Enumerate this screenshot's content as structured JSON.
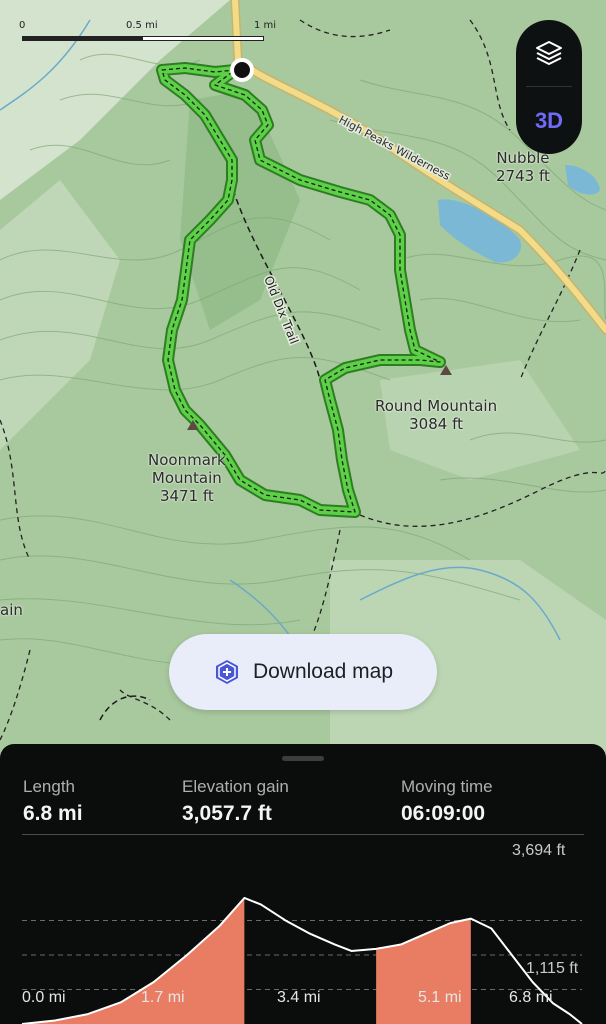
{
  "map": {
    "scale": {
      "tick_0": "0",
      "tick_1": "0.5 mi",
      "tick_2": "1 mi"
    },
    "labels": {
      "nubble": "Nubble\n2743 ft",
      "round_mountain": "Round Mountain\n3084 ft",
      "noonmark": "Noonmark\nMountain\n3471 ft",
      "partial": "ain",
      "old_dix_trail": "Old Dix Trail",
      "high_peaks": "High Peaks Wilderness"
    },
    "colors": {
      "route": "#4fbf3a",
      "road": "#f2dc8a",
      "water": "#7ab8d6",
      "terrain": "#a9c9a0"
    }
  },
  "controls": {
    "layers_icon": "layers-icon",
    "btn_3d": "3D"
  },
  "download": {
    "label": "Download map",
    "icon": "shield-plus-icon"
  },
  "stats": {
    "length_label": "Length",
    "length_value": "6.8 mi",
    "gain_label": "Elevation gain",
    "gain_value": "3,057.7 ft",
    "time_label": "Moving time",
    "time_value": "06:09:00"
  },
  "chart_data": {
    "type": "area",
    "x_unit": "mi",
    "y_unit": "ft",
    "ylim": [
      1115,
      3694
    ],
    "xlim": [
      0,
      6.8
    ],
    "y_tick_labels": [
      "3,694 ft",
      "1,115 ft"
    ],
    "x_tick_labels": [
      "0.0 mi",
      "1.7 mi",
      "3.4 mi",
      "5.1 mi",
      "6.8 mi"
    ],
    "grid": true,
    "profile": [
      [
        0.0,
        1115
      ],
      [
        0.4,
        1180
      ],
      [
        0.8,
        1300
      ],
      [
        1.2,
        1520
      ],
      [
        1.6,
        1900
      ],
      [
        2.0,
        2400
      ],
      [
        2.4,
        2950
      ],
      [
        2.7,
        3470
      ],
      [
        2.9,
        3350
      ],
      [
        3.2,
        3050
      ],
      [
        3.5,
        2800
      ],
      [
        3.8,
        2600
      ],
      [
        4.0,
        2480
      ],
      [
        4.3,
        2520
      ],
      [
        4.6,
        2600
      ],
      [
        4.9,
        2800
      ],
      [
        5.2,
        3000
      ],
      [
        5.45,
        3084
      ],
      [
        5.7,
        2900
      ],
      [
        5.95,
        2400
      ],
      [
        6.2,
        1900
      ],
      [
        6.45,
        1500
      ],
      [
        6.65,
        1300
      ],
      [
        6.8,
        1115
      ]
    ],
    "highlight_ranges": [
      [
        0.0,
        2.7
      ],
      [
        4.3,
        5.45
      ]
    ],
    "colors": {
      "fill": "#e87d63",
      "line": "#ffffff",
      "grid": "#6a6b6b"
    }
  }
}
